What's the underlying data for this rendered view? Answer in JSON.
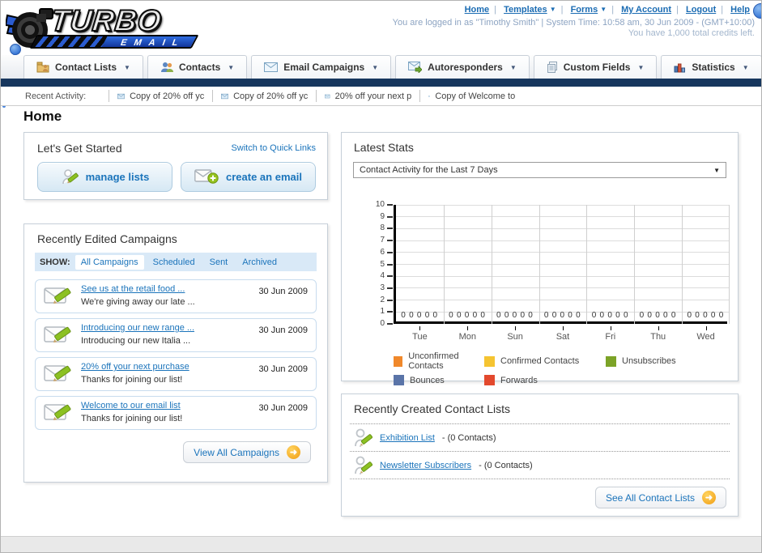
{
  "brand": {
    "turbo": "TURBO",
    "email": "EMAIL"
  },
  "header": {
    "links": [
      {
        "label": "Home",
        "dropdown": false
      },
      {
        "label": "Templates",
        "dropdown": true
      },
      {
        "label": "Forms",
        "dropdown": true
      },
      {
        "label": "My Account",
        "dropdown": false
      },
      {
        "label": "Logout",
        "dropdown": false
      },
      {
        "label": "Help",
        "dropdown": false
      }
    ],
    "login_status": "You are logged in as \"Timothy Smith\" | System Time: 10:58 am, 30 Jun 2009 - (GMT+10:00)",
    "credits": "You have 1,000 total credits left."
  },
  "nav": {
    "tabs": [
      {
        "label": "Contact Lists"
      },
      {
        "label": "Contacts"
      },
      {
        "label": "Email Campaigns"
      },
      {
        "label": "Autoresponders"
      },
      {
        "label": "Custom Fields"
      },
      {
        "label": "Statistics"
      }
    ]
  },
  "recent_activity": {
    "label": "Recent Activity:",
    "items": [
      "Copy of 20% off yc",
      "Copy of 20% off yc",
      "20% off your next p",
      "Copy of Welcome to"
    ]
  },
  "home": {
    "title": "Home"
  },
  "get_started": {
    "title": "Let's Get Started",
    "switch_link": "Switch to Quick Links",
    "manage_lists_label": "manage lists",
    "create_email_label": "create an email"
  },
  "campaigns": {
    "title": "Recently Edited Campaigns",
    "show_label": "SHOW:",
    "filters": [
      "All Campaigns",
      "Scheduled",
      "Sent",
      "Archived"
    ],
    "active_filter": "All Campaigns",
    "items": [
      {
        "title": "See us at the retail food ...",
        "subtitle": "We're giving away our late ...",
        "date": "30 Jun 2009"
      },
      {
        "title": "Introducing our new range ...",
        "subtitle": "Introducing our new Italia ...",
        "date": "30 Jun 2009"
      },
      {
        "title": "20% off your next purchase",
        "subtitle": "Thanks for joining our list!",
        "date": "30 Jun 2009"
      },
      {
        "title": "Welcome to our email list",
        "subtitle": "Thanks for joining our list!",
        "date": "30 Jun 2009"
      }
    ],
    "view_all_label": "View All Campaigns"
  },
  "stats": {
    "title": "Latest Stats",
    "dropdown_value": "Contact Activity for the Last 7 Days"
  },
  "chart_data": {
    "type": "bar",
    "title": "Contact Activity for the Last 7 Days",
    "categories": [
      "Tue",
      "Mon",
      "Sun",
      "Sat",
      "Fri",
      "Thu",
      "Wed"
    ],
    "series": [
      {
        "name": "Unconfirmed Contacts",
        "color": "#f0882b",
        "values": [
          0,
          0,
          0,
          0,
          0,
          0,
          0
        ]
      },
      {
        "name": "Confirmed Contacts",
        "color": "#f5c431",
        "values": [
          0,
          0,
          0,
          0,
          0,
          0,
          0
        ]
      },
      {
        "name": "Unsubscribes",
        "color": "#7ca327",
        "values": [
          0,
          0,
          0,
          0,
          0,
          0,
          0
        ]
      },
      {
        "name": "Bounces",
        "color": "#5a74a8",
        "values": [
          0,
          0,
          0,
          0,
          0,
          0,
          0
        ]
      },
      {
        "name": "Forwards",
        "color": "#e3492d",
        "values": [
          0,
          0,
          0,
          0,
          0,
          0,
          0
        ]
      }
    ],
    "ylim": [
      0,
      10
    ],
    "yticks": [
      0,
      1,
      2,
      3,
      4,
      5,
      6,
      7,
      8,
      9,
      10
    ],
    "grid": true,
    "legend_position": "bottom",
    "value_labels_shown": true
  },
  "contact_lists": {
    "title": "Recently Created Contact Lists",
    "items": [
      {
        "name": "Exhibition List",
        "suffix": " - (0 Contacts)"
      },
      {
        "name": "Newsletter Subscribers",
        "suffix": " - (0 Contacts)"
      }
    ],
    "see_all_label": "See All Contact Lists"
  },
  "colors": {
    "accent_blue": "#1b74bb",
    "navy_bar": "#17375e",
    "go_button_orange": "#f0a218",
    "logo_blue": "#1d4fc0"
  }
}
